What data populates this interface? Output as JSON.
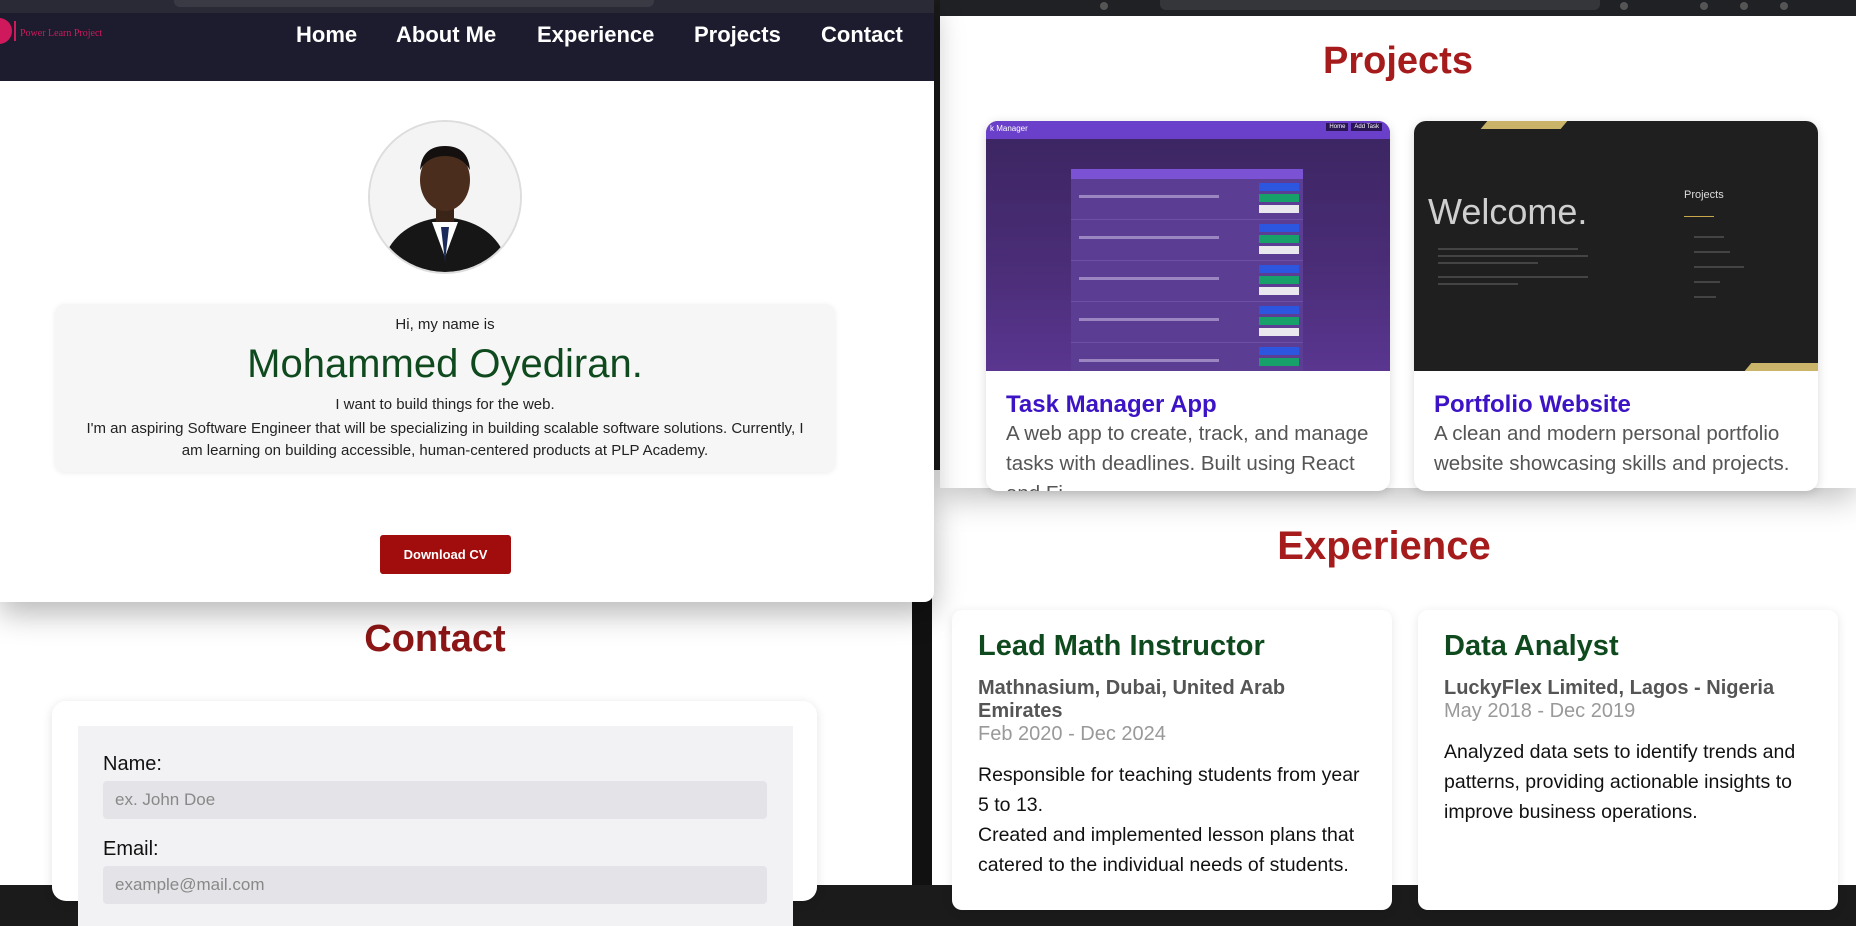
{
  "hero": {
    "logo_text": "Power Learn Project",
    "nav": [
      "Home",
      "About Me",
      "Experience",
      "Projects",
      "Contact"
    ],
    "greeting": "Hi, my name is",
    "name": "Mohammed Oyediran.",
    "tagline": "I want to build things for the web.",
    "bio": "I'm an aspiring Software Engineer that will be specializing in building scalable software solutions. Currently, I am learning on building accessible, human-centered products at PLP Academy.",
    "cv_button": "Download CV"
  },
  "projects": {
    "title": "Projects",
    "items": [
      {
        "title": "Task Manager App",
        "description": "A web app to create, track, and manage tasks with deadlines. Built using React and Fi",
        "thumb": {
          "brand": "k Manager",
          "nav": [
            "Home",
            "Add Task"
          ]
        }
      },
      {
        "title": "Portfolio Website",
        "description": "A clean and modern personal portfolio website showcasing skills and projects.",
        "thumb": {
          "welcome": "Welcome.",
          "projects_label": "Projects"
        }
      }
    ]
  },
  "experience": {
    "title": "Experience",
    "items": [
      {
        "role": "Lead Math Instructor",
        "company": "Mathnasium, Dubai, United Arab Emirates",
        "dates": "Feb 2020 - Dec 2024",
        "lines": [
          "Responsible for teaching students from year 5 to 13.",
          "Created and implemented lesson plans that catered to the individual needs of students."
        ]
      },
      {
        "role": "Data Analyst",
        "company": "LuckyFlex Limited, Lagos - Nigeria",
        "dates": "May 2018 - Dec 2019",
        "lines": [
          "Analyzed data sets to identify trends and patterns, providing actionable insights to improve business operations."
        ]
      }
    ]
  },
  "contact": {
    "title": "Contact",
    "name_label": "Name:",
    "name_placeholder": "ex. John Doe",
    "email_label": "Email:",
    "email_placeholder": "example@mail.com"
  },
  "colors": {
    "heading_red": "#a61c1c",
    "name_green": "#0f4a1e",
    "project_link": "#3c14c6",
    "nav_bg": "#1c1c2e",
    "brand_pink": "#d0195d",
    "cv_button": "#a10d0d"
  }
}
